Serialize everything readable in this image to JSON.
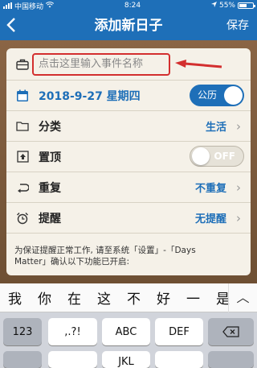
{
  "status_bar": {
    "carrier": "中国移动",
    "time": "8:24",
    "battery": "55%"
  },
  "nav": {
    "title": "添加新日子",
    "save_label": "保存"
  },
  "form": {
    "name_placeholder": "点击这里输入事件名称",
    "date": "2018-9-27 星期四",
    "calendar_mode": "公历",
    "category": {
      "label": "分类",
      "value": "生活"
    },
    "pin": {
      "label": "置顶",
      "toggle": "OFF"
    },
    "repeat": {
      "label": "重复",
      "value": "不重复"
    },
    "reminder": {
      "label": "提醒",
      "value": "无提醒"
    },
    "note_line1": "为保证提醒正常工作, 请至系统「设置」-「Days",
    "note_line2": "Matter」确认以下功能已开启:"
  },
  "keyboard": {
    "candidates": [
      "我",
      "你",
      "在",
      "这",
      "不",
      "好",
      "一",
      "是"
    ],
    "keys": [
      "123",
      ",.?!",
      "ABC",
      "DEF"
    ],
    "next_row": [
      "",
      "",
      "JKL",
      ""
    ]
  },
  "colors": {
    "accent": "#1e6fb8",
    "highlight": "#d32f2f",
    "panel": "#f5f1e8"
  }
}
